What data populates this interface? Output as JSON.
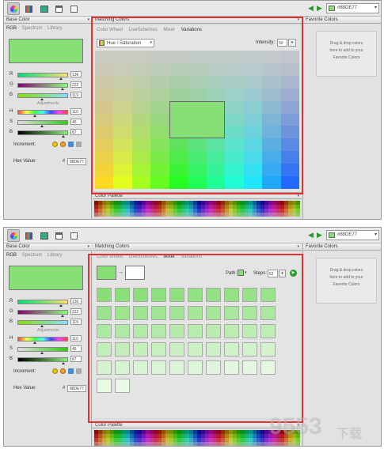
{
  "toolbar": {
    "hex_value": "#88DE77",
    "active_tool_icons": [
      "color-wheel-icon",
      "swatch-grid-icon",
      "palette-icon",
      "window-icon",
      "picker-icon"
    ]
  },
  "left_panel": {
    "title": "Base Color",
    "tabs": [
      "RGB",
      "Spectrum",
      "Library"
    ],
    "current_color": "#88de77",
    "rgb": [
      {
        "label": "R",
        "value": "136"
      },
      {
        "label": "G",
        "value": "222"
      },
      {
        "label": "B",
        "value": "119"
      }
    ],
    "adjustments_label": "Adjustments",
    "hsb": [
      {
        "label": "H",
        "value": "110"
      },
      {
        "label": "S",
        "value": "46"
      },
      {
        "label": "B",
        "value": "87"
      }
    ],
    "increment_label": "Increment:",
    "hex_label": "Hex Value:",
    "hex_hash": "#",
    "hex_value": "88DE77"
  },
  "matching_colors": {
    "title": "Matching Colors",
    "tabs": [
      "Color Wheel",
      "LiveSchemes",
      "Mixer",
      "Variations"
    ],
    "screen1_active_tab": "Variations",
    "screen2_active_tab": "Mixer",
    "variations": {
      "mode_label": "Hue / Saturation",
      "intensity_label": "Intensity:",
      "intensity_value": "50"
    },
    "mixer": {
      "path_label": "Path:",
      "steps_label": "Steps:",
      "steps_value": "52",
      "start_color": "#88de77",
      "end_color": "#ffffff"
    }
  },
  "favorites": {
    "title": "Favorite Colors",
    "hint_lines": [
      "Drag & drop colors",
      "here to add to your",
      "Favorite Colors"
    ]
  },
  "palette": {
    "title": "Color Palette"
  },
  "watermark": {
    "text1": "9553",
    "text2": "下载"
  }
}
